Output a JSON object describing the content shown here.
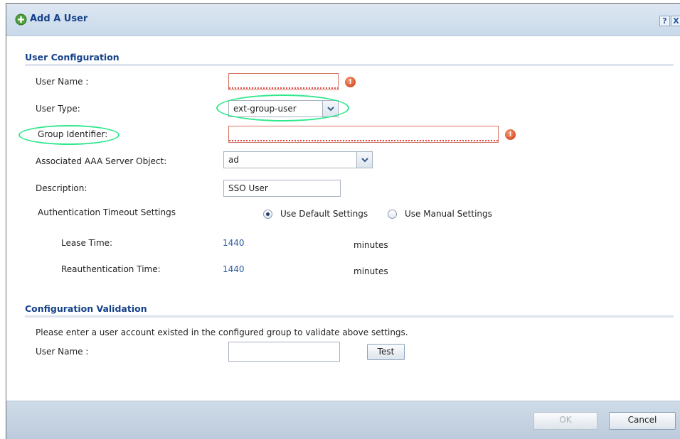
{
  "dialog": {
    "title": "Add A User",
    "help_label": "?",
    "close_label": "X"
  },
  "user_config": {
    "section_title": "User Configuration",
    "user_name_label": "User Name :",
    "user_name_value": "",
    "user_type_label": "User Type:",
    "user_type_value": "ext-group-user",
    "group_identifier_label": "Group Identifier:",
    "group_identifier_value": "",
    "aaa_label": "Associated AAA Server Object:",
    "aaa_value": "ad",
    "description_label": "Description:",
    "description_value": "SSO User",
    "auth_timeout_label": "Authentication Timeout Settings",
    "use_default_label": "Use Default Settings",
    "use_manual_label": "Use Manual Settings",
    "selected_timeout_mode": "default",
    "lease_time_label": "Lease Time:",
    "lease_time_value": "1440",
    "lease_time_unit": "minutes",
    "reauth_time_label": "Reauthentication Time:",
    "reauth_time_value": "1440",
    "reauth_time_unit": "minutes",
    "error_marker": "!"
  },
  "validation": {
    "section_title": "Configuration Validation",
    "instruction": "Please enter a user account existed in the configured group to validate above settings.",
    "user_name_label": "User Name :",
    "user_name_value": "",
    "test_label": "Test"
  },
  "footer": {
    "ok_label": "OK",
    "cancel_label": "Cancel"
  },
  "colors": {
    "title_text": "#15428b",
    "highlight_ring": "#2ee88c",
    "error_icon": "#d9502a",
    "value_blue": "#2a5aa0"
  }
}
